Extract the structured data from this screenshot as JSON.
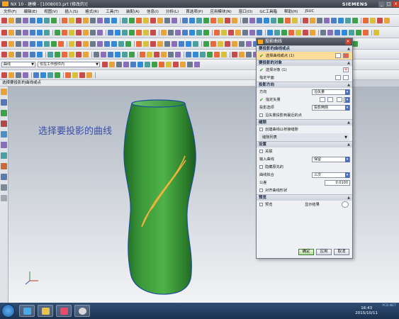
{
  "window": {
    "title": "NX 10 - 建模 - [1008003.prt (修改的)]",
    "brand": "SIEMENS",
    "controls": [
      "_",
      "□",
      "x"
    ]
  },
  "menubar": [
    "文件(F)",
    "编辑(E)",
    "视图(V)",
    "插入(S)",
    "格式(R)",
    "工具(T)",
    "装配(A)",
    "信息(I)",
    "分析(L)",
    "首选项(P)",
    "应用模块(N)",
    "窗口(O)",
    "GC工具箱",
    "帮助(H)",
    "JSUC"
  ],
  "selection_bar": {
    "filter": "曲线",
    "scope": "仅在工作部件内"
  },
  "prompt": "选择要投影的曲线或点",
  "viewport": {
    "hint": "选择要投影的曲线"
  },
  "dialog": {
    "title": "投影曲线",
    "sections": {
      "curves": {
        "title": "要投影的曲线或点",
        "row": "选择曲线或点 (1)"
      },
      "target": {
        "title": "要投影的对象",
        "select": "选择对象 (1)",
        "plane": "指定平面"
      },
      "direction": {
        "title": "投影方向",
        "dir_label": "方向",
        "dir_value": "沿矢量",
        "vec_label": "指定矢量",
        "opt_label": "投影选项",
        "opt_value": "投影两侧",
        "near_label": "沿矢量投影到最近的点"
      },
      "gap": {
        "title": "缝隙",
        "create": "创建曲线以桥接缝隙",
        "list": "缝隙列表"
      },
      "settings": {
        "title": "设置",
        "assoc": "关联",
        "input_label": "输入曲线",
        "input_value": "保留",
        "hide_label": "隐藏原先的",
        "curve_fit_label": "曲线拟合",
        "curve_fit_value": "三次",
        "tol_label": "公差",
        "tol_value": "0.0100",
        "align_label": "对齐曲线形状"
      },
      "preview": {
        "title": "预览",
        "preview": "预览",
        "show": "显示结果"
      }
    },
    "buttons": {
      "ok": "确定",
      "apply": "应用",
      "cancel": "取消"
    }
  },
  "taskbar": {
    "time": "16:43",
    "date": "2015/10/11",
    "watermark": "PCB.NET"
  },
  "colors": {
    "model": "#3c9a3a",
    "curve": "#f0b23c",
    "hint_text": "#3a4ea8",
    "dialog_selected": "#fbdc98"
  }
}
